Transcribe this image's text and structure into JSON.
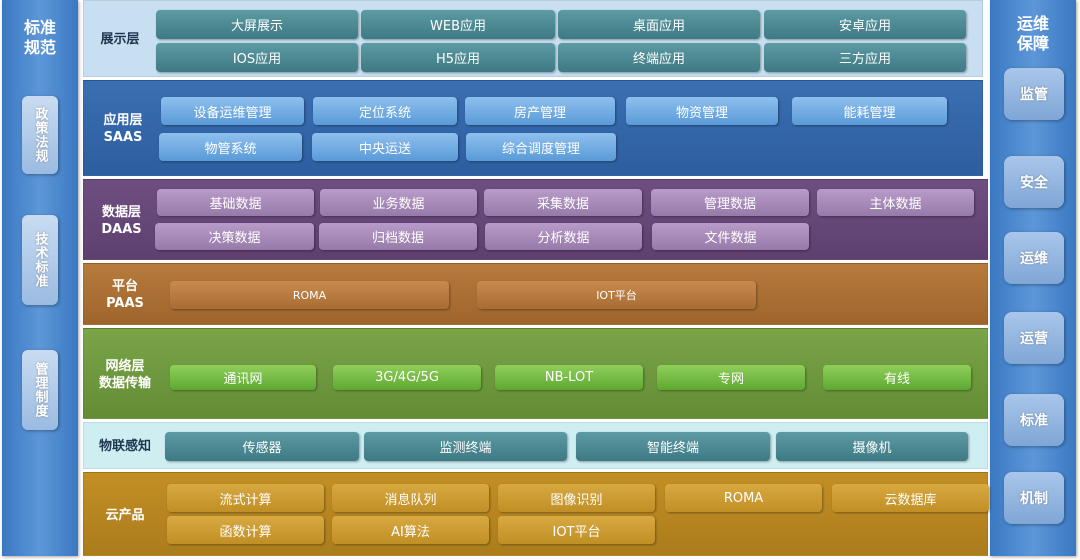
{
  "left": {
    "title": [
      "标准",
      "规范"
    ],
    "items": [
      "政策法规",
      "技术标准",
      "管理制度"
    ]
  },
  "right": {
    "title": [
      "运维",
      "保障"
    ],
    "items": [
      "监管",
      "安全",
      "运维",
      "运营",
      "标准",
      "机制"
    ]
  },
  "layers": {
    "display": {
      "label": [
        "展示层"
      ],
      "items": [
        "大屏展示",
        "WEB应用",
        "桌面应用",
        "安卓应用",
        "IOS应用",
        "H5应用",
        "终端应用",
        "三方应用"
      ]
    },
    "saas": {
      "label": [
        "应用层",
        "SAAS"
      ],
      "items": [
        "设备运维管理",
        "定位系统",
        "房产管理",
        "物资管理",
        "能耗管理",
        "物管系统",
        "中央运送",
        "综合调度管理"
      ]
    },
    "daas": {
      "label": [
        "数据层",
        "DAAS"
      ],
      "items": [
        "基础数据",
        "业务数据",
        "采集数据",
        "管理数据",
        "主体数据",
        "决策数据",
        "归档数据",
        "分析数据",
        "文件数据"
      ]
    },
    "paas": {
      "label": [
        "平台",
        "PAAS"
      ],
      "items": [
        "ROMA",
        "IOT平台"
      ]
    },
    "network": {
      "label": [
        "网络层",
        "数据传输"
      ],
      "items": [
        "通讯网",
        "3G/4G/5G",
        "NB-LOT",
        "专网",
        "有线"
      ]
    },
    "iot": {
      "label": [
        "物联感知"
      ],
      "items": [
        "传感器",
        "监测终端",
        "智能终端",
        "摄像机"
      ]
    },
    "cloud": {
      "label": [
        "云产品"
      ],
      "items": [
        "流式计算",
        "消息队列",
        "图像识别",
        "ROMA",
        "云数据库",
        "函数计算",
        "AI算法",
        "IOT平台"
      ]
    }
  }
}
